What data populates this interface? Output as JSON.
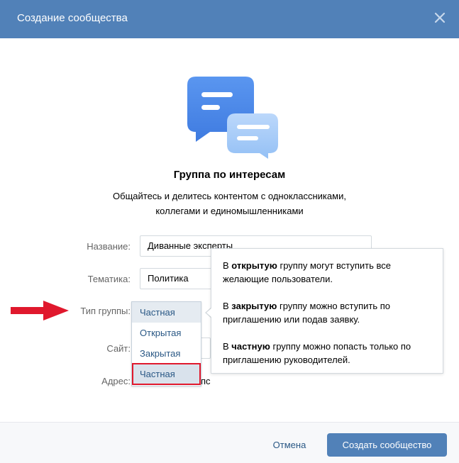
{
  "header": {
    "title": "Создание сообщества"
  },
  "group": {
    "title": "Группа по интересам",
    "description_line1": "Общайтесь и делитесь контентом с одноклассниками,",
    "description_line2": "коллегами и единомышленниками"
  },
  "form": {
    "name_label": "Название:",
    "name_value": "Диванные эксперты",
    "topic_label": "Тематика:",
    "topic_value": "Политика",
    "type_label": "Тип группы:",
    "site_label": "Сайт:",
    "address_label": "Адрес:",
    "address_partial": "пс"
  },
  "dropdown": {
    "options": [
      "Частная",
      "Открытая",
      "Закрытая",
      "Частная"
    ]
  },
  "tooltip": {
    "p1_prefix": "В ",
    "p1_bold": "открытую",
    "p1_suffix": " группу могут вступить все желающие пользователи.",
    "p2_prefix": "В ",
    "p2_bold": "закрытую",
    "p2_suffix": " группу можно вступить по приглашению или подав заявку.",
    "p3_prefix": "В ",
    "p3_bold": "частную",
    "p3_suffix": " группу можно попасть только по приглашению руководителей."
  },
  "footer": {
    "cancel_label": "Отмена",
    "create_label": "Создать сообщество"
  },
  "colors": {
    "header_bg": "#5181b8",
    "link": "#2a5885",
    "highlight_border": "#e0182d",
    "arrow": "#e0182d"
  },
  "icons": {
    "close": "close-icon",
    "illustration": "chat-bubbles-illustration",
    "arrow": "red-arrow-pointer"
  }
}
